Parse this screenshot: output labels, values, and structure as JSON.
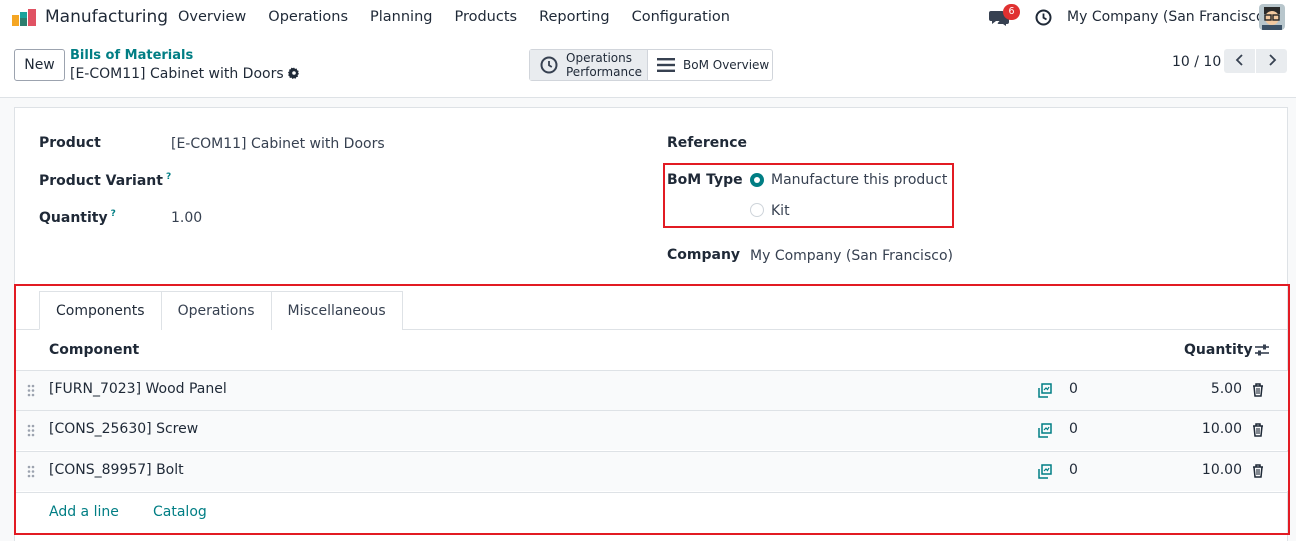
{
  "navbar": {
    "app_name": "Manufacturing",
    "menu": [
      "Overview",
      "Operations",
      "Planning",
      "Products",
      "Reporting",
      "Configuration"
    ],
    "chat_badge": "6",
    "company": "My Company (San Francisco)"
  },
  "control": {
    "new_label": "New",
    "breadcrumb_parent": "Bills of Materials",
    "breadcrumb_current": "[E-COM11] Cabinet with Doors",
    "smart_buttons": {
      "operations_line1": "Operations",
      "operations_line2": "Performance",
      "bom_overview": "BoM Overview"
    },
    "pager": "10 / 10"
  },
  "form": {
    "product_label": "Product",
    "product_value": "[E-COM11] Cabinet with Doors",
    "variant_label": "Product Variant",
    "quantity_label": "Quantity",
    "quantity_value": "1.00",
    "help_mark": "?",
    "reference_label": "Reference",
    "bom_type_label": "BoM Type",
    "bom_type_options": [
      "Manufacture this product",
      "Kit"
    ],
    "bom_type_selected": "Manufacture this product",
    "company_label": "Company",
    "company_value": "My Company (San Francisco)"
  },
  "notebook": {
    "tabs": [
      "Components",
      "Operations",
      "Miscellaneous"
    ],
    "active_tab": "Components",
    "columns": {
      "component": "Component",
      "quantity": "Quantity"
    },
    "rows": [
      {
        "component": "[FURN_7023] Wood Panel",
        "available": "0",
        "quantity": "5.00"
      },
      {
        "component": "[CONS_25630] Screw",
        "available": "0",
        "quantity": "10.00"
      },
      {
        "component": "[CONS_89957] Bolt",
        "available": "0",
        "quantity": "10.00"
      }
    ],
    "add_line": "Add a line",
    "catalog": "Catalog"
  },
  "colors": {
    "accent": "#017e84",
    "highlight": "#e21b23",
    "badge": "#e03131"
  }
}
